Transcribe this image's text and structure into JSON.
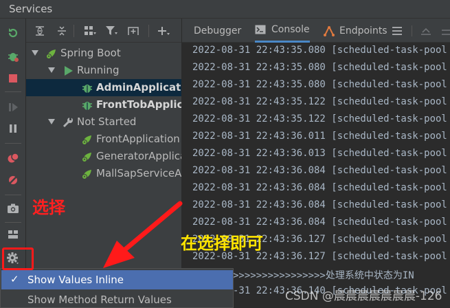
{
  "window": {
    "title": "Services"
  },
  "tree": {
    "items": [
      {
        "label": "Spring Boot",
        "level": 0,
        "icon": "spring-boot-icon",
        "expanded": true,
        "bold": false,
        "selected": false
      },
      {
        "label": "Running",
        "level": 1,
        "icon": "run-icon",
        "expanded": true,
        "bold": false,
        "selected": false
      },
      {
        "label": "AdminApplication",
        "level": 2,
        "icon": "debug-bug-icon",
        "bold": true,
        "selected": true
      },
      {
        "label": "FrontTobApplication",
        "level": 2,
        "icon": "debug-bug-icon",
        "bold": true,
        "selected": false
      },
      {
        "label": "Not Started",
        "level": 1,
        "icon": "wrench-icon",
        "expanded": true,
        "bold": false,
        "selected": false
      },
      {
        "label": "FrontApplication",
        "level": 2,
        "icon": "spring-app-icon",
        "bold": false,
        "selected": false
      },
      {
        "label": "GeneratorApplication",
        "level": 2,
        "icon": "spring-app-icon",
        "bold": false,
        "selected": false
      },
      {
        "label": "MallSapServiceApplication",
        "level": 2,
        "icon": "spring-app-icon",
        "bold": false,
        "selected": false
      }
    ]
  },
  "tabs": [
    {
      "label": "Debugger",
      "active": false
    },
    {
      "label": "Console",
      "active": true
    },
    {
      "label": "Endpoints",
      "active": false
    }
  ],
  "console": {
    "lines": [
      "2022-08-31 22:43:35.080 [scheduled-task-pool",
      "2022-08-31 22:43:35.080 [scheduled-task-pool",
      "2022-08-31 22:43:35.080 [scheduled-task-pool",
      "2022-08-31 22:43:35.122 [scheduled-task-pool",
      "2022-08-31 22:43:35.122 [scheduled-task-pool",
      "2022-08-31 22:43:36.011 [scheduled-task-pool",
      "2022-08-31 22:43:36.013 [scheduled-task-pool",
      "2022-08-31 22:43:36.084 [scheduled-task-pool",
      "2022-08-31 22:43:36.084 [scheduled-task-pool",
      "2022-08-31 22:43:36.084 [scheduled-task-pool",
      "2022-08-31 22:43:36.084 [scheduled-task-pool",
      "2022-08-31 22:43:36.127 [scheduled-task-pool",
      "2022-08-31 22:43:36.127 [scheduled-task-pool",
      ">>>>>>>>>>>>>>>>>>>>>>>处理系统中状态为IN",
      "2022-08-31 22:43:36.140 [scheduled-task-pool"
    ]
  },
  "popup_menu": {
    "items": [
      {
        "label": "Show Values Inline",
        "checked": true,
        "highlighted": true
      },
      {
        "label": "Show Method Return Values",
        "checked": false,
        "highlighted": false
      }
    ]
  },
  "annotations": {
    "label_select": "选择",
    "label_select_then_ok": "在选择即可",
    "watermark": "CSDN @晨晨晨晨晨晨晨-126"
  },
  "colors": {
    "accent": "#4b6eaf",
    "tab_active": "#4a88c7",
    "annotation_red": "#ff1a1a",
    "annotation_yellow": "#ffe400",
    "spring_green": "#6db33f"
  }
}
